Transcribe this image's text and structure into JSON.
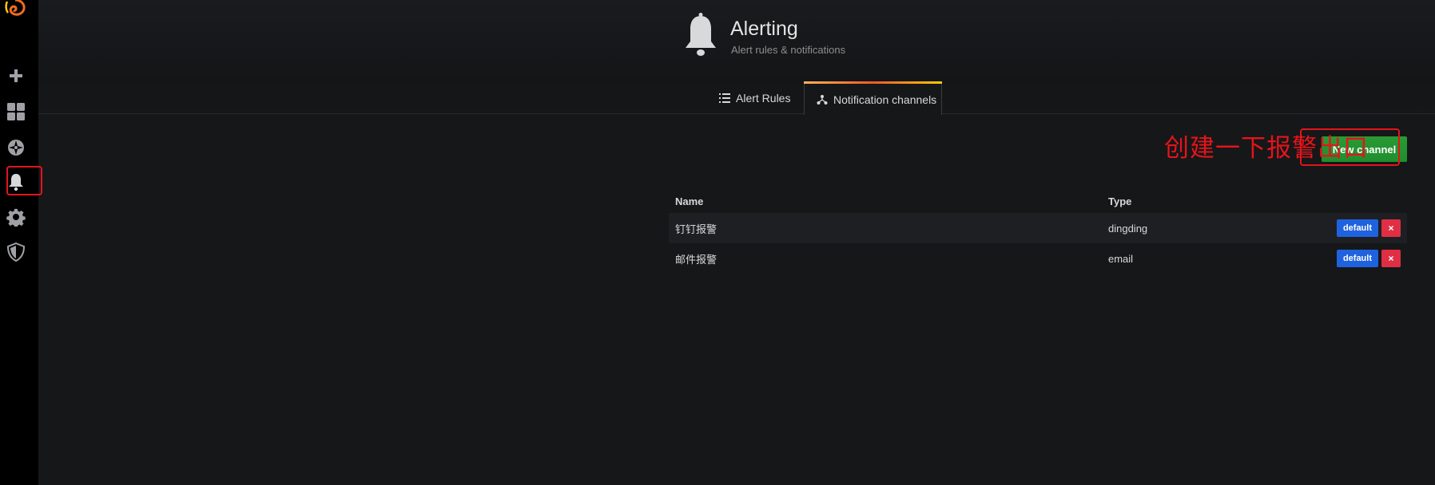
{
  "header": {
    "title": "Alerting",
    "subtitle": "Alert rules & notifications"
  },
  "tabs": [
    {
      "label": "Alert Rules",
      "icon": "list-icon",
      "active": false
    },
    {
      "label": "Notification channels",
      "icon": "share-icon",
      "active": true
    }
  ],
  "actions": {
    "new_channel_label": "New channel"
  },
  "annotation": {
    "text": "创建一下报警出口",
    "color": "#e4141a"
  },
  "table": {
    "columns": [
      "Name",
      "Type"
    ],
    "rows": [
      {
        "name": "钉钉报警",
        "type": "dingding",
        "default_label": "default",
        "delete_label": "×"
      },
      {
        "name": "邮件报警",
        "type": "email",
        "default_label": "default",
        "delete_label": "×"
      }
    ]
  },
  "sidebar": {
    "items": [
      {
        "icon": "plus-icon"
      },
      {
        "icon": "dashboards-icon"
      },
      {
        "icon": "explore-icon"
      },
      {
        "icon": "bell-icon",
        "active": true
      },
      {
        "icon": "gear-icon"
      },
      {
        "icon": "shield-icon"
      }
    ]
  },
  "colors": {
    "primary_green": "#1f8e2d",
    "default_blue": "#1f62e0",
    "delete_red": "#e02f44",
    "tab_accent": "#f05a28"
  }
}
